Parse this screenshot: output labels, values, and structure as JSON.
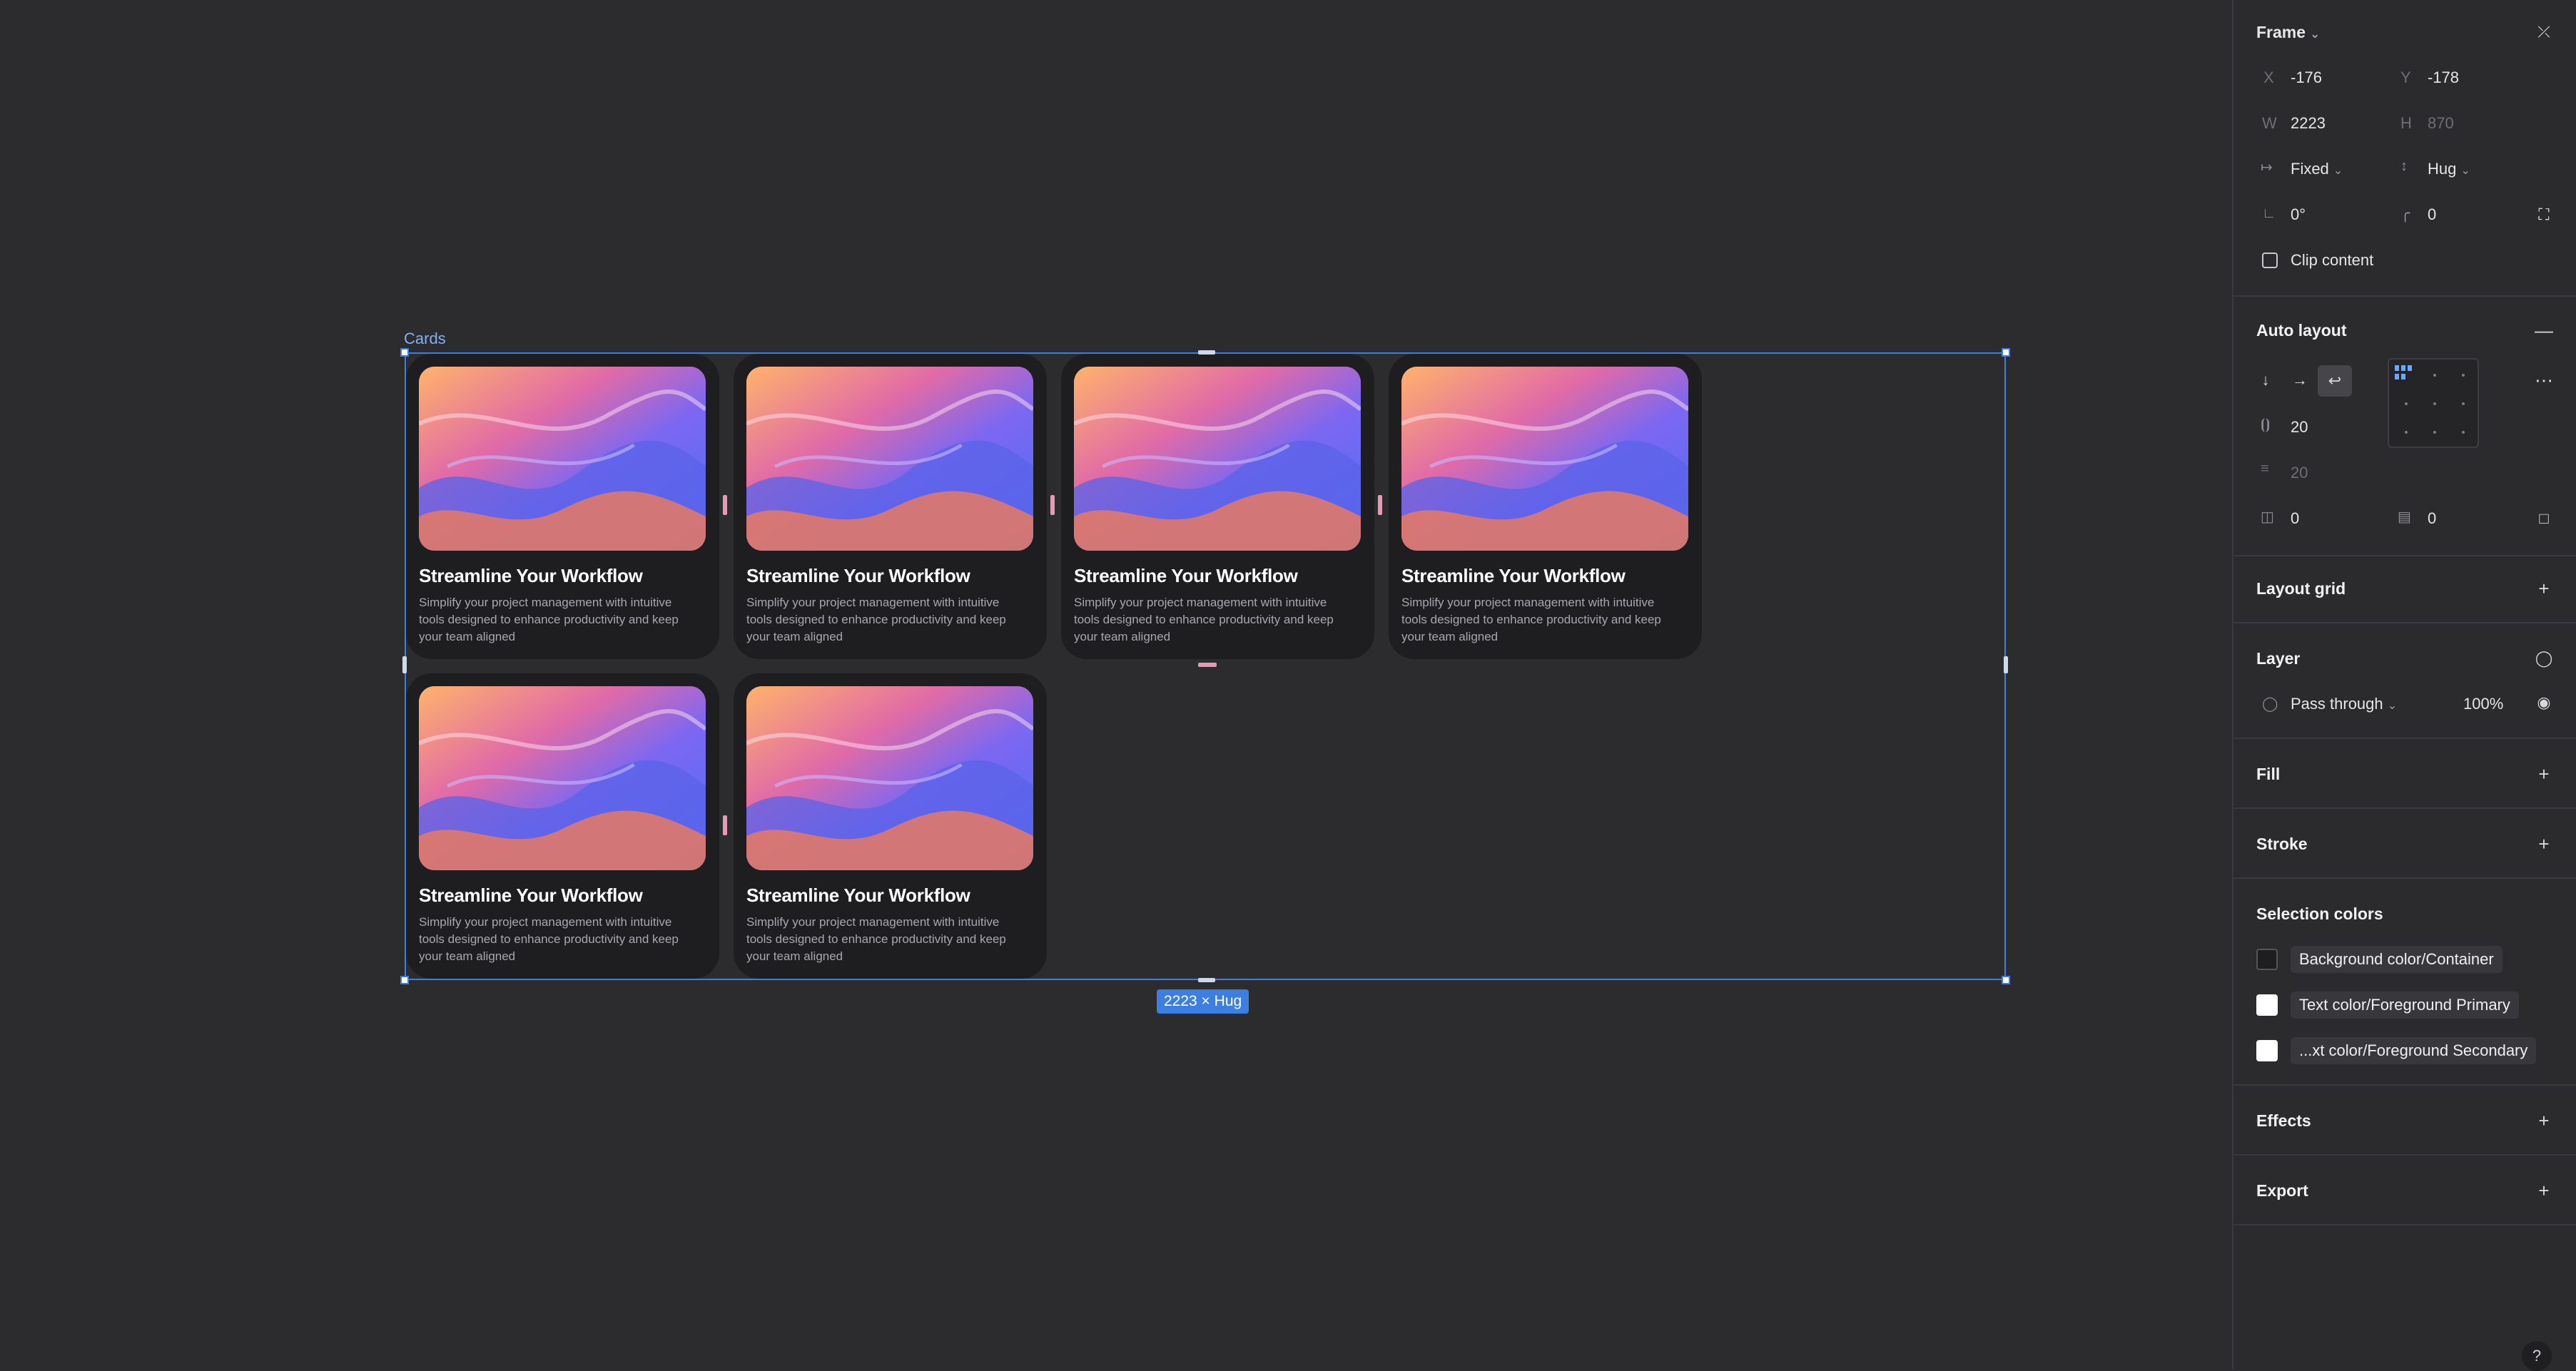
{
  "canvas": {
    "frame_label": "Cards",
    "size_badge": "2223 × Hug"
  },
  "cards": [
    {
      "title": "Streamline Your Workflow",
      "description": "Simplify your project management with intuitive tools designed to enhance productivity and keep your team aligned"
    },
    {
      "title": "Streamline Your Workflow",
      "description": "Simplify your project management with intuitive tools designed to enhance productivity and keep your team aligned"
    },
    {
      "title": "Streamline Your Workflow",
      "description": "Simplify your project management with intuitive tools designed to enhance productivity and keep your team aligned"
    },
    {
      "title": "Streamline Your Workflow",
      "description": "Simplify your project management with intuitive tools designed to enhance productivity and keep your team aligned"
    },
    {
      "title": "Streamline Your Workflow",
      "description": "Simplify your project management with intuitive tools designed to enhance productivity and keep your team aligned"
    },
    {
      "title": "Streamline Your Workflow",
      "description": "Simplify your project management with intuitive tools designed to enhance productivity and keep your team aligned"
    }
  ],
  "panel": {
    "frame": {
      "title": "Frame",
      "x_label": "X",
      "x_value": "-176",
      "y_label": "Y",
      "y_value": "-178",
      "w_label": "W",
      "w_value": "2223",
      "h_label": "H",
      "h_value": "870",
      "width_mode": "Fixed",
      "height_mode": "Hug",
      "rotation": "0°",
      "corner_radius": "0",
      "clip_content": "Clip content"
    },
    "auto_layout": {
      "title": "Auto layout",
      "horizontal_gap": "20",
      "vertical_gap": "20",
      "horizontal_padding": "0",
      "vertical_padding": "0"
    },
    "layout_grid": {
      "title": "Layout grid"
    },
    "layer": {
      "title": "Layer",
      "blend_mode": "Pass through",
      "opacity": "100%"
    },
    "fill": {
      "title": "Fill"
    },
    "stroke": {
      "title": "Stroke"
    },
    "selection_colors": {
      "title": "Selection colors",
      "items": [
        {
          "label": "Background color/Container",
          "color": "#1e1e21"
        },
        {
          "label": "Text color/Foreground Primary",
          "color": "#ffffff"
        },
        {
          "label": "...xt color/Foreground Secondary",
          "color": "#ffffff"
        }
      ]
    },
    "effects": {
      "title": "Effects"
    },
    "export": {
      "title": "Export"
    },
    "help": "?"
  },
  "colors": {
    "canvas_bg": "#2c2c2f",
    "selection_blue": "#3d7fe0",
    "card_bg": "#1e1e21"
  }
}
